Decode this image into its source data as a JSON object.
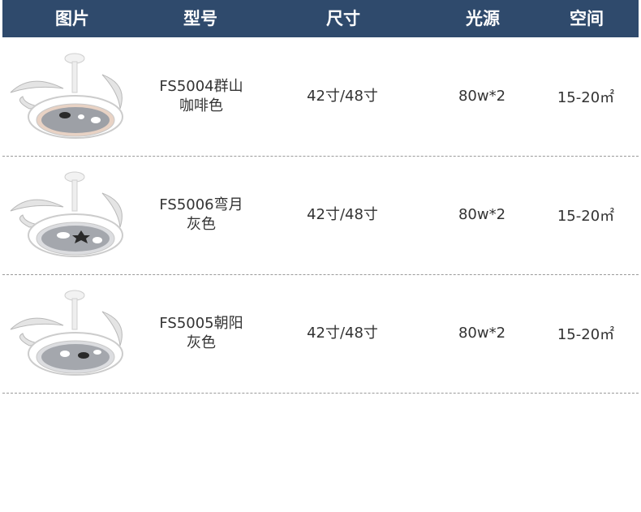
{
  "header": {
    "col_image": "图片",
    "col_model": "型号",
    "col_size": "尺寸",
    "col_light": "光源",
    "col_space": "空间"
  },
  "rows": [
    {
      "model_line1": "FS5004群山",
      "model_line2": "咖啡色",
      "size": "42寸/48寸",
      "light": "80w*2",
      "space": "15-20㎡",
      "ring_color": "#e8d2c4",
      "image_icon": "ceiling-fan-light-icon"
    },
    {
      "model_line1": "FS5006弯月",
      "model_line2": "灰色",
      "size": "42寸/48寸",
      "light": "80w*2",
      "space": "15-20㎡",
      "ring_color": "#dcdde0",
      "image_icon": "ceiling-fan-light-icon"
    },
    {
      "model_line1": "FS5005朝阳",
      "model_line2": "灰色",
      "size": "42寸/48寸",
      "light": "80w*2",
      "space": "15-20㎡",
      "ring_color": "#dcdde0",
      "image_icon": "ceiling-fan-light-icon"
    }
  ],
  "colors": {
    "header_bg": "#2f4a6c",
    "header_text": "#ffffff",
    "divider": "#9a9a9a"
  }
}
